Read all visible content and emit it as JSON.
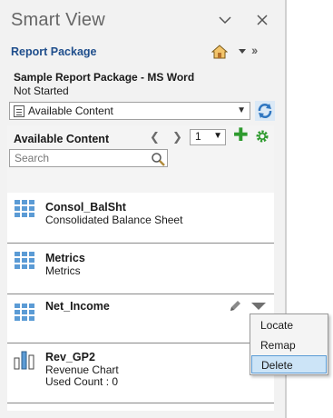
{
  "panel": {
    "title": "Smart View",
    "collapse_icon": "chevron-down-icon",
    "close_icon": "close-icon"
  },
  "toolbar": {
    "section_label": "Report Package",
    "home_icon": "home-icon",
    "more_icon": "double-chevron-right-icon"
  },
  "package": {
    "name": "Sample Report Package - MS Word",
    "status": "Not Started"
  },
  "content_select": {
    "value": "Available Content",
    "refresh_icon": "refresh-icon"
  },
  "available_content": {
    "heading": "Available Content",
    "page": "1",
    "search_placeholder": "Search",
    "items": [
      {
        "name": "Consol_BalSht",
        "description": "Consolidated Balance Sheet",
        "icon": "grid-icon"
      },
      {
        "name": "Metrics",
        "description": "Metrics",
        "icon": "grid-icon"
      },
      {
        "name": "Net_Income",
        "description": "",
        "icon": "grid-icon"
      },
      {
        "name": "Rev_GP2",
        "description": "Revenue Chart",
        "extra": "Used Count : 0",
        "icon": "bar-chart-icon"
      }
    ]
  },
  "context_menu": {
    "items": [
      "Locate",
      "Remap",
      "Delete"
    ],
    "selected": "Delete"
  },
  "colors": {
    "accent_blue": "#1f4e8c",
    "icon_blue": "#5b9bd5",
    "add_green": "#2e9a2e",
    "menu_highlight": "#cce4f7"
  }
}
